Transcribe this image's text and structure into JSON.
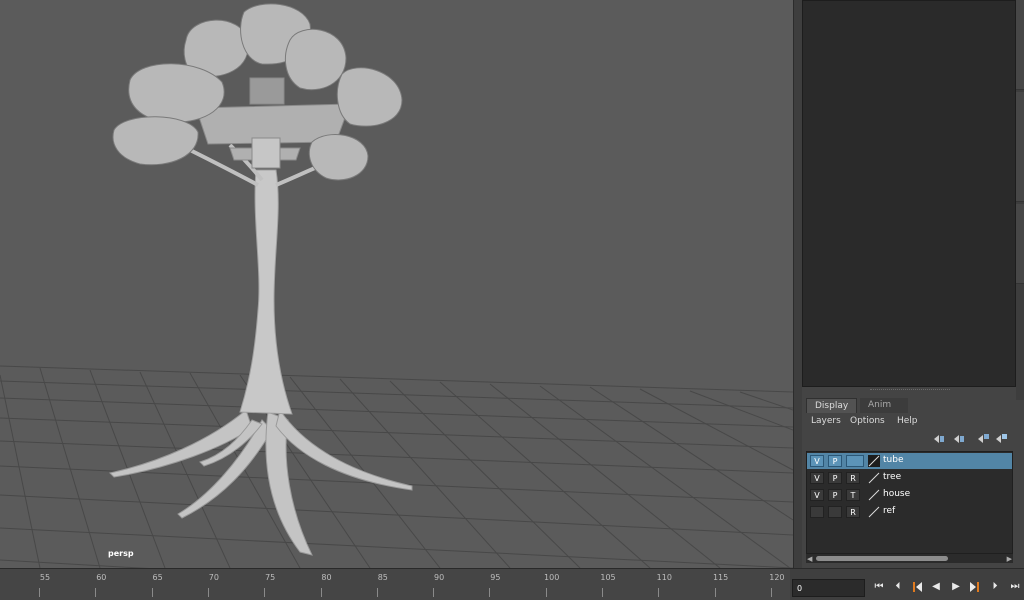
{
  "viewport": {
    "camera_label": "persp"
  },
  "layer_editor": {
    "tabs": [
      {
        "label": "Display",
        "active": true
      },
      {
        "label": "Anim",
        "active": false
      }
    ],
    "menus": [
      "Layers",
      "Options",
      "Help"
    ],
    "layers": [
      {
        "name": "tube",
        "v": "V",
        "p": "P",
        "t": "",
        "selected": true,
        "color": "#1c1c1c"
      },
      {
        "name": "tree",
        "v": "V",
        "p": "P",
        "t": "R",
        "selected": false,
        "color": "#2b2b2b"
      },
      {
        "name": "house",
        "v": "V",
        "p": "P",
        "t": "T",
        "selected": false,
        "color": "#2b2b2b"
      },
      {
        "name": "ref",
        "v": "",
        "p": "",
        "t": "R",
        "selected": false,
        "color": "#2b2b2b"
      }
    ]
  },
  "timeline": {
    "ticks": [
      "55",
      "60",
      "65",
      "70",
      "75",
      "80",
      "85",
      "90",
      "95",
      "100",
      "105",
      "110",
      "115",
      "120"
    ],
    "current_frame": "0",
    "buttons": [
      "go-to-start",
      "step-back-key",
      "step-back-frame",
      "play-backward",
      "play-forward",
      "step-forward-frame",
      "step-forward-key",
      "go-to-end"
    ]
  },
  "colors": {
    "viewport_bg": "#5b5b5b",
    "selection": "#5285a6",
    "key_marker": "#e07a1f"
  }
}
